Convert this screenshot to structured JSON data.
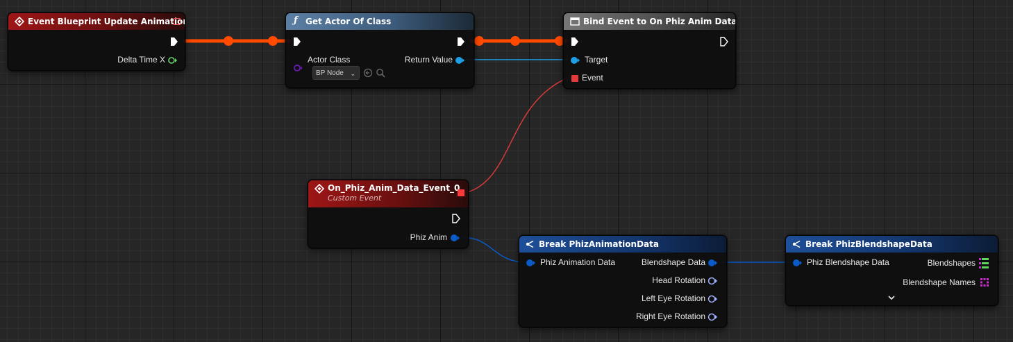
{
  "nodes": {
    "event_update": {
      "title": "Event Blueprint Update Animation",
      "outputs": {
        "delta_time": "Delta Time X"
      }
    },
    "get_actor": {
      "title": "Get Actor Of Class",
      "inputs": {
        "actor_class": "Actor Class",
        "class_value": "BP Node"
      },
      "outputs": {
        "return_value": "Return Value"
      }
    },
    "bind_event": {
      "title": "Bind Event to On Phiz Anim Data",
      "inputs": {
        "target": "Target",
        "event": "Event"
      }
    },
    "custom_event": {
      "title": "On_Phiz_Anim_Data_Event_0",
      "subtitle": "Custom Event",
      "outputs": {
        "phiz_anim": "Phiz Anim"
      }
    },
    "break_anim": {
      "title": "Break PhizAnimationData",
      "inputs": {
        "phiz_animation_data": "Phiz Animation Data"
      },
      "outputs": {
        "blendshape_data": "Blendshape Data",
        "head_rotation": "Head Rotation",
        "left_eye_rotation": "Left Eye Rotation",
        "right_eye_rotation": "Right Eye Rotation"
      }
    },
    "break_blend": {
      "title": "Break PhizBlendshapeData",
      "inputs": {
        "phiz_blendshape_data": "Phiz Blendshape Data"
      },
      "outputs": {
        "blendshapes": "Blendshapes",
        "blendshape_names": "Blendshape Names"
      }
    }
  },
  "colors": {
    "exec_wire": "#ff4a00",
    "delegate": "#e03a3a",
    "object": "#1e9fe6",
    "struct": "#0a5ac8",
    "float": "#6cd66c",
    "class": "#6a1ab8",
    "rotator": "#9fb0ff",
    "array_float": "#5cd65c",
    "array_name": "#c82cc8"
  },
  "icons": {
    "event": "event-diamond-icon",
    "function": "function-f-icon",
    "bind": "bind-window-icon",
    "break": "break-struct-icon"
  }
}
